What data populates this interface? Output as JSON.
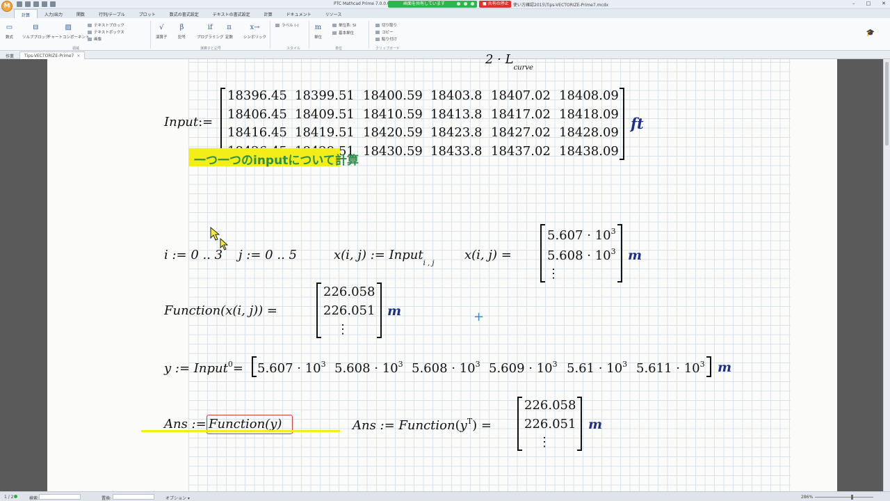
{
  "titlebar": {
    "app_orb": "M",
    "window_title": "PTC Mathcad Prime 7.0.0.0 -",
    "share_text": "画面を共有しています",
    "stop_share": "■ 共有の停止",
    "file_path": "使い方確認2015\\Tips-VECTORIZE-Prime7.mcdx"
  },
  "ribbon": {
    "tabs": [
      "計算",
      "入力/出力",
      "関数",
      "行列/テーブル",
      "プロット",
      "数式の書式設定",
      "テキストの書式設定",
      "計算",
      "ドキュメント",
      "リソース"
    ],
    "active_tab_index": 0,
    "groups": {
      "math_region": "数式",
      "solve_block": "ソルブブロック",
      "chart_component": "チャートコンポーネント",
      "text_block": "テキストブロック",
      "text_box": "テキストボックス",
      "image": "画像",
      "region_label": "領域",
      "operators": "演算子",
      "symbols": "記号",
      "programming": "プログラミング",
      "constants": "定数",
      "symbolic": "シンボリック",
      "operators_group": "演算子と記号",
      "label_dropdown": "ラベル (-)",
      "style_group": "スタイル",
      "units": "単位",
      "unit_system": "単位系: SI",
      "base_units": "基本単位",
      "units_group": "単位",
      "cut": "切り取り",
      "copy": "コピー",
      "paste": "貼り付け",
      "clipboard_group": "クリップボード"
    }
  },
  "doc_tabs": {
    "first": "作業",
    "active": "Tips-VECTORIZE-Prime7",
    "close": "×"
  },
  "worksheet": {
    "top_fragment": "2 · L",
    "top_fragment_sub": "curve",
    "input_label": "Input",
    "assign": ":=",
    "input_matrix": [
      [
        "18396.45",
        "18399.51",
        "18400.59",
        "18403.8",
        "18407.02",
        "18408.09"
      ],
      [
        "18406.45",
        "18409.51",
        "18410.59",
        "18413.8",
        "18417.02",
        "18418.09"
      ],
      [
        "18416.45",
        "18419.51",
        "18420.59",
        "18423.8",
        "18427.02",
        "18428.09"
      ],
      [
        "18426.45",
        "18429.51",
        "18430.59",
        "18433.8",
        "18437.02",
        "18438.09"
      ]
    ],
    "input_unit": "ft",
    "heading": "一つ一つのinputについて計算",
    "range_i": "i := 0 .. 3",
    "range_j": "j := 0 .. 5",
    "x_def_lhs": "x(i, j) := Input",
    "x_def_sub": "i , j",
    "x_eval_lhs": "x(i, j) =",
    "x_result": [
      "5.607 · 10",
      "5.608 · 10",
      "⋮"
    ],
    "exp3": "3",
    "unit_m": "m",
    "fn_lhs": "Function(x(i, j)) =",
    "fn_result": [
      "226.058",
      "226.051",
      "⋮"
    ],
    "y_lhs": "y := Input",
    "y_col": "0",
    "y_eq": "=",
    "y_row": [
      "5.607 · 10",
      "5.608 · 10",
      "5.608 · 10",
      "5.609 · 10",
      "5.61 · 10",
      "5.611 · 10"
    ],
    "ans1_lhs": "Ans :=",
    "ans1_rhs": "Function(y)",
    "ans2_lhs": "Ans := Function",
    "ans2_arg": "y",
    "ans2_T": "T",
    "ans2_eq": "=",
    "ans2_result": [
      "226.058",
      "226.051",
      "⋮"
    ]
  },
  "statusbar": {
    "page": "1 / 2",
    "find_label": "検索:",
    "replace_label": "置換:",
    "options": "オプション ▾",
    "zoom": "286%"
  }
}
